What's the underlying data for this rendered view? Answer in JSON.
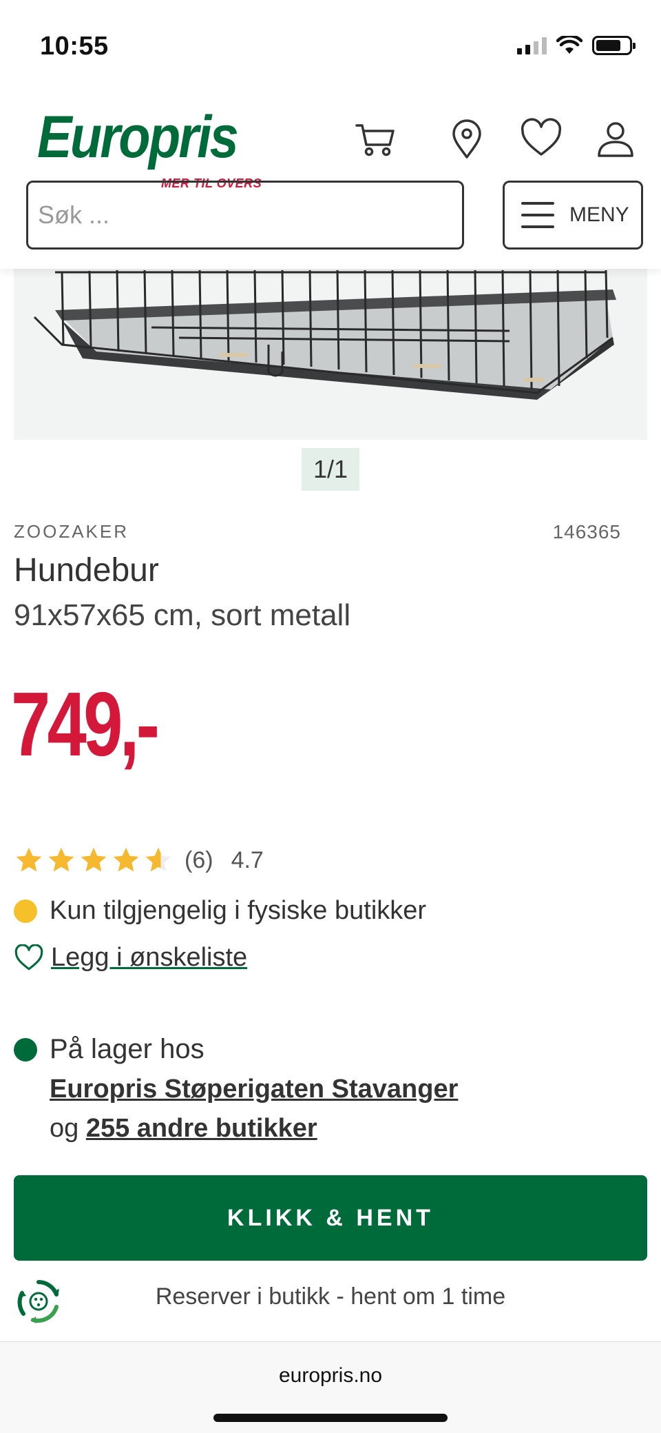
{
  "status_bar": {
    "time": "10:55"
  },
  "header": {
    "logo": {
      "name": "Europris",
      "tagline": "MER TIL OVERS"
    },
    "icons": [
      "cart-icon",
      "location-pin-icon",
      "heart-icon",
      "user-icon"
    ],
    "search": {
      "placeholder": "Søk ..."
    },
    "menu": {
      "label": "MENY"
    }
  },
  "gallery": {
    "pager": "1/1"
  },
  "product": {
    "brand": "ZOOZAKER",
    "sku": "146365",
    "title": "Hundebur",
    "subtitle": "91x57x65 cm, sort metall",
    "price": "749,-",
    "rating": {
      "stars": 4.7,
      "count": "(6)",
      "value": "4.7"
    },
    "availability": "Kun tilgjengelig i fysiske butikker",
    "wishlist_label": "Legg i ønskeliste",
    "stock": {
      "label": "På lager hos",
      "store": "Europris Støperigaten Stavanger",
      "prefix": "og",
      "others": "255 andre butikker"
    },
    "cta_label": "KLIKK & HENT",
    "reserve_text": "Reserver i butikk - hent om 1 time"
  },
  "colors": {
    "brand_green": "#006b3a",
    "price_red": "#d3183a",
    "star_yellow": "#f5b82e",
    "availability_dot": "#f5c02a"
  },
  "browser": {
    "url": "europris.no"
  }
}
